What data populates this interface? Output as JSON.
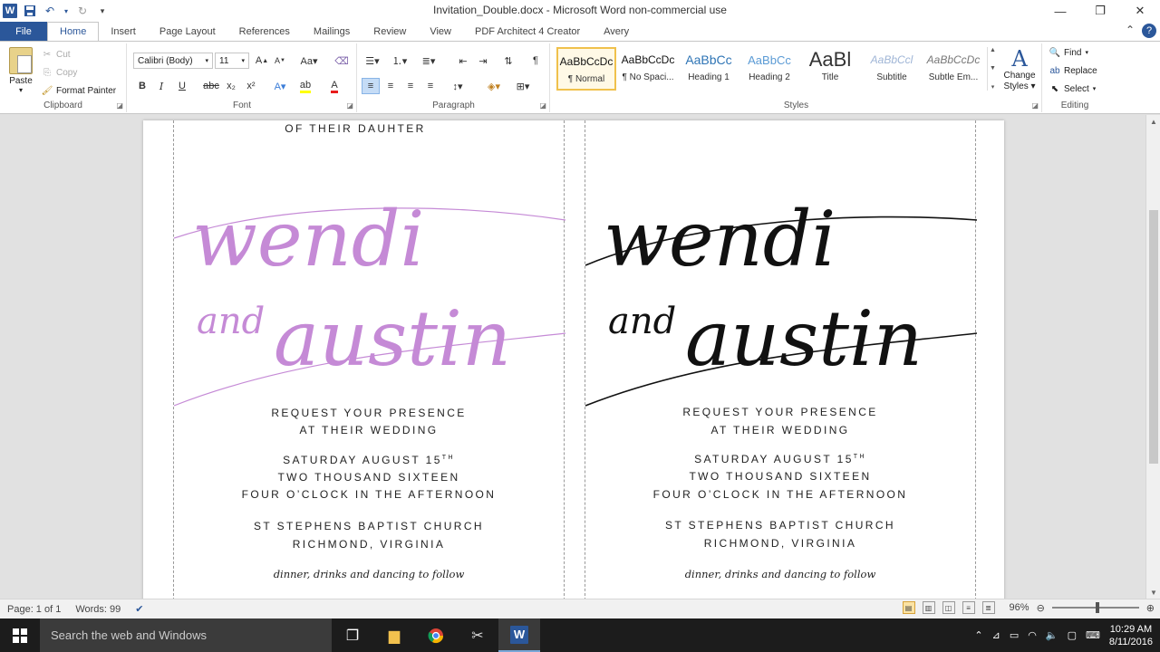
{
  "window": {
    "title": "Invitation_Double.docx - Microsoft Word non-commercial use",
    "logo": "W"
  },
  "tabs": [
    {
      "label": "File"
    },
    {
      "label": "Home"
    },
    {
      "label": "Insert"
    },
    {
      "label": "Page Layout"
    },
    {
      "label": "References"
    },
    {
      "label": "Mailings"
    },
    {
      "label": "Review"
    },
    {
      "label": "View"
    },
    {
      "label": "PDF Architect 4 Creator"
    },
    {
      "label": "Avery"
    }
  ],
  "clipboard": {
    "paste": "Paste",
    "cut": "Cut",
    "copy": "Copy",
    "format_painter": "Format Painter",
    "label": "Clipboard"
  },
  "font": {
    "name": "Calibri (Body)",
    "size": "11",
    "label": "Font"
  },
  "paragraph": {
    "label": "Paragraph"
  },
  "styles": {
    "label": "Styles",
    "items": [
      {
        "preview": "AaBbCcDc",
        "name": "¶ Normal"
      },
      {
        "preview": "AaBbCcDc",
        "name": "¶ No Spaci..."
      },
      {
        "preview": "AaBbCc",
        "name": "Heading 1"
      },
      {
        "preview": "AaBbCc",
        "name": "Heading 2"
      },
      {
        "preview": "AaBl",
        "name": "Title"
      },
      {
        "preview": "AaBbCcl",
        "name": "Subtitle"
      },
      {
        "preview": "AaBbCcDc",
        "name": "Subtle Em..."
      }
    ],
    "change_styles_line1": "Change",
    "change_styles_line2": "Styles"
  },
  "editing": {
    "find": "Find",
    "replace": "Replace",
    "select": "Select",
    "label": "Editing"
  },
  "invitation": {
    "top_line": "OF THEIR DAUHTER",
    "name1": "wendi",
    "and": "and",
    "name2": "austin",
    "request1": "REQUEST YOUR PRESENCE",
    "request2": "AT THEIR WEDDING",
    "date_line": "SATURDAY AUGUST 15",
    "date_sup": "TH",
    "year_line": "TWO THOUSAND SIXTEEN",
    "time_line": "FOUR O’CLOCK IN THE AFTERNOON",
    "venue1": "ST STEPHENS BAPTIST CHURCH",
    "venue2": "RICHMOND, VIRGINIA",
    "footer": "dinner, drinks and dancing to follow",
    "left_color": "#c58ad6",
    "right_color": "#111111"
  },
  "status": {
    "page": "Page: 1 of 1",
    "words": "Words: 99",
    "zoom": "96%"
  },
  "taskbar": {
    "search_placeholder": "Search the web and Windows",
    "time": "10:29 AM",
    "date": "8/11/2016"
  }
}
